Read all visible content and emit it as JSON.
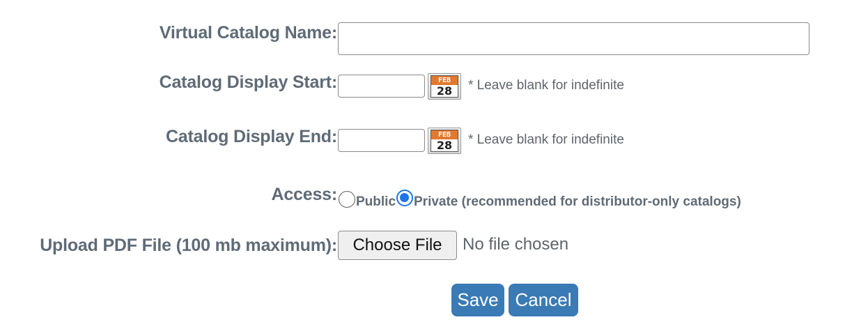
{
  "form": {
    "name": {
      "label": "Virtual Catalog Name:",
      "value": ""
    },
    "start": {
      "label": "Catalog Display Start:",
      "value": "",
      "hint": "* Leave blank for indefinite"
    },
    "end": {
      "label": "Catalog Display End:",
      "value": "",
      "hint": "* Leave blank for indefinite"
    },
    "calendar_icon": {
      "name": "calendar-icon",
      "month": "FEB",
      "day": "28"
    },
    "access": {
      "label": "Access:",
      "options": [
        {
          "label": "Public",
          "selected": false
        },
        {
          "label": "Private (recommended for distributor-only catalogs)",
          "selected": true
        }
      ]
    },
    "upload": {
      "label": "Upload PDF File (100 mb maximum):",
      "button_label": "Choose File",
      "status": "No file chosen"
    },
    "save_label": "Save",
    "cancel_label": "Cancel"
  },
  "colors": {
    "label_text": "#5f6b76",
    "primary_button": "#3a7ab5",
    "radio_selected": "#1f74e6",
    "calendar_month_bg": "#e2792e"
  }
}
